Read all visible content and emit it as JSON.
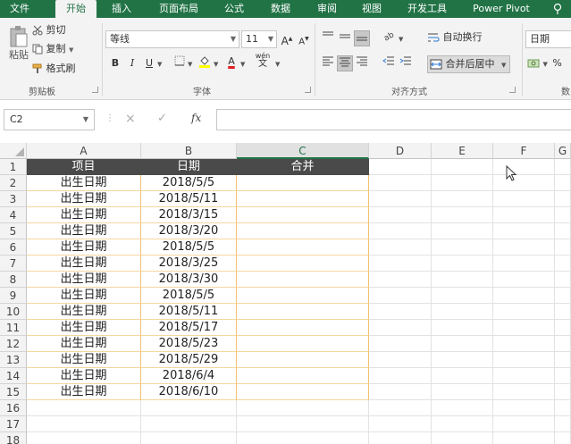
{
  "tabs": [
    {
      "label": "文件",
      "active": false
    },
    {
      "label": "开始",
      "active": true
    },
    {
      "label": "插入",
      "active": false
    },
    {
      "label": "页面布局",
      "active": false
    },
    {
      "label": "公式",
      "active": false
    },
    {
      "label": "数据",
      "active": false
    },
    {
      "label": "审阅",
      "active": false
    },
    {
      "label": "视图",
      "active": false
    },
    {
      "label": "开发工具",
      "active": false
    },
    {
      "label": "Power Pivot",
      "active": false
    }
  ],
  "ribbon": {
    "clipboard": {
      "paste": "粘贴",
      "cut": "剪切",
      "copy": "复制",
      "format_painter": "格式刷",
      "group_label": "剪贴板"
    },
    "font": {
      "font_name": "等线",
      "font_size": "11",
      "grow": "A",
      "shrink": "A",
      "bold": "B",
      "italic": "I",
      "underline": "U",
      "font_color": "A",
      "phonetic": "wén",
      "phonetic_char": "文",
      "group_label": "字体"
    },
    "alignment": {
      "wrap_text": "自动换行",
      "merge_center": "合并后居中",
      "group_label": "对齐方式"
    },
    "number": {
      "format": "日期",
      "percent": "%",
      "group_label": "数"
    }
  },
  "formula_bar": {
    "name_box": "C2",
    "cancel": "×",
    "enter": "✓",
    "fx": "fx",
    "value": ""
  },
  "sheet": {
    "columns": [
      "A",
      "B",
      "C",
      "D",
      "E",
      "F",
      "G"
    ],
    "active_column": "C",
    "row_numbers": [
      "1",
      "2",
      "3",
      "4",
      "5",
      "6",
      "7",
      "8",
      "9",
      "10",
      "11",
      "12",
      "13",
      "14",
      "15",
      "16",
      "17",
      "18"
    ],
    "headers": [
      "项目",
      "日期",
      "合并"
    ],
    "rows": [
      {
        "a": "出生日期",
        "b": "2018/5/5",
        "c": ""
      },
      {
        "a": "出生日期",
        "b": "2018/5/11",
        "c": ""
      },
      {
        "a": "出生日期",
        "b": "2018/3/15",
        "c": ""
      },
      {
        "a": "出生日期",
        "b": "2018/3/20",
        "c": ""
      },
      {
        "a": "出生日期",
        "b": "2018/5/5",
        "c": ""
      },
      {
        "a": "出生日期",
        "b": "2018/3/25",
        "c": ""
      },
      {
        "a": "出生日期",
        "b": "2018/3/30",
        "c": ""
      },
      {
        "a": "出生日期",
        "b": "2018/5/5",
        "c": ""
      },
      {
        "a": "出生日期",
        "b": "2018/5/11",
        "c": ""
      },
      {
        "a": "出生日期",
        "b": "2018/5/17",
        "c": ""
      },
      {
        "a": "出生日期",
        "b": "2018/5/23",
        "c": ""
      },
      {
        "a": "出生日期",
        "b": "2018/5/29",
        "c": ""
      },
      {
        "a": "出生日期",
        "b": "2018/6/4",
        "c": ""
      },
      {
        "a": "出生日期",
        "b": "2018/6/10",
        "c": ""
      }
    ]
  },
  "colors": {
    "brand": "#217346",
    "header_fill": "#4a4a4a",
    "table_border": "#f0c070"
  }
}
